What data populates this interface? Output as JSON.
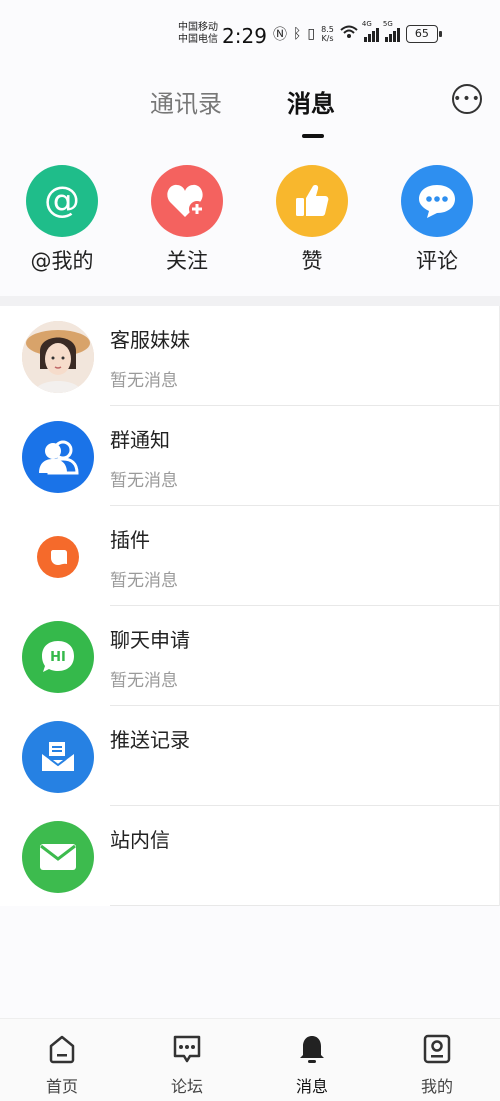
{
  "status": {
    "carrier1": "中国移动",
    "carrier2": "中国电信",
    "time": "2:29",
    "net_speed_value": "8.5",
    "net_speed_unit": "K/s",
    "sig1_label": "4G",
    "sig2_label": "5G",
    "battery": "65"
  },
  "tabs": {
    "contacts": "通讯录",
    "messages": "消息"
  },
  "quick_actions": [
    {
      "label": "@我的",
      "color": "#1fbd8a",
      "icon": "at-icon"
    },
    {
      "label": "关注",
      "color": "#f4625f",
      "icon": "heart-plus-icon"
    },
    {
      "label": "赞",
      "color": "#f8b72d",
      "icon": "thumbs-up-icon"
    },
    {
      "label": "评论",
      "color": "#2e8ff0",
      "icon": "chat-bubble-icon"
    }
  ],
  "messages": [
    {
      "title": "客服妹妹",
      "subtitle": "暂无消息",
      "color": "#e9d3c4",
      "icon": "profile-photo"
    },
    {
      "title": "群通知",
      "subtitle": "暂无消息",
      "color": "#1a73e8",
      "icon": "group-icon"
    },
    {
      "title": "插件",
      "subtitle": "暂无消息",
      "color": "#f56a2b",
      "icon": "plugin-icon"
    },
    {
      "title": "聊天申请",
      "subtitle": "暂无消息",
      "color": "#35b94b",
      "icon": "hi-bubble-icon",
      "icon_text": "HI"
    },
    {
      "title": "推送记录",
      "subtitle": "",
      "color": "#2681e3",
      "icon": "inbox-icon"
    },
    {
      "title": "站内信",
      "subtitle": "",
      "color": "#3dbb4e",
      "icon": "envelope-icon"
    }
  ],
  "nav": [
    {
      "label": "首页",
      "icon": "home-icon"
    },
    {
      "label": "论坛",
      "icon": "forum-icon"
    },
    {
      "label": "消息",
      "icon": "bell-icon",
      "active": true
    },
    {
      "label": "我的",
      "icon": "profile-icon"
    }
  ]
}
